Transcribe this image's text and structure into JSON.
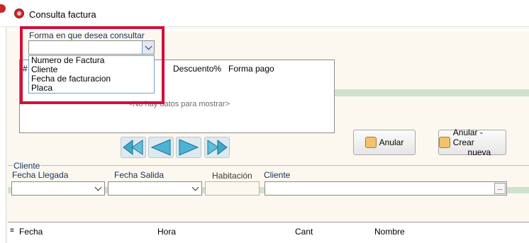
{
  "window": {
    "title": "Consulta factura"
  },
  "consulta": {
    "label": "Forma en que desea consultar",
    "value": "",
    "options": [
      "Numero de Factura",
      "Cliente",
      "Fecha de facturacion",
      "Placa"
    ]
  },
  "grid_top": {
    "columns": [
      "#",
      "Descuento%",
      "Forma pago"
    ],
    "empty_message": "<No hay datos para mostrar>"
  },
  "nav_buttons": [
    "first-icon",
    "previous-icon",
    "next-icon",
    "last-icon"
  ],
  "actions": {
    "anular": "Anular",
    "anular_crear_1": "Anular - Crear",
    "anular_crear_2": "nueva"
  },
  "cliente_group": {
    "title": "Cliente",
    "fecha_llegada_label": "Fecha Llegada",
    "fecha_salida_label": "Fecha Salida",
    "habitacion_label": "Habitación",
    "cliente_label": "Cliente",
    "fecha_llegada": "",
    "fecha_salida": "",
    "habitacion": "",
    "cliente": "",
    "ellipsis": "..."
  },
  "grid_bottom": {
    "columns": [
      "Fecha",
      "Hora",
      "Cant",
      "Nombre"
    ]
  },
  "colors": {
    "highlight": "#d0103a",
    "panel_bg": "#fdf8ef",
    "green_band": "#cfe3cc",
    "nav_blue": "#3fa7c9"
  }
}
